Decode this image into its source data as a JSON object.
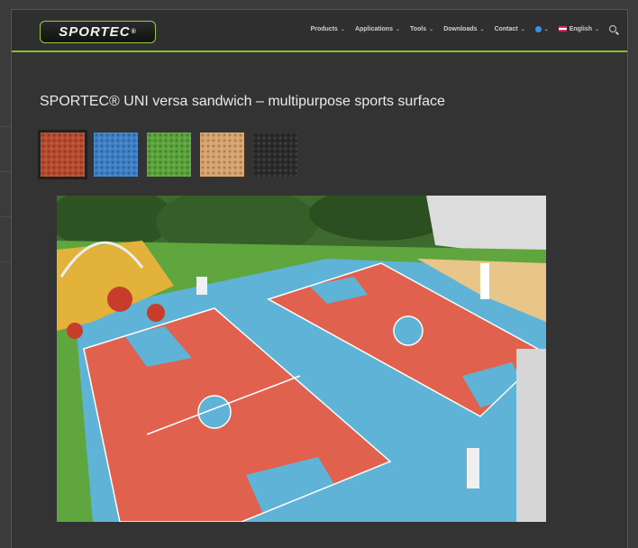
{
  "header": {
    "logo_text": "SPORTEC",
    "logo_mark": "®",
    "nav": [
      {
        "label": "Products"
      },
      {
        "label": "Applications"
      },
      {
        "label": "Tools"
      },
      {
        "label": "Downloads"
      },
      {
        "label": "Contact"
      }
    ],
    "language": "English",
    "accent_color": "#8bbd2d"
  },
  "page": {
    "title": "SPORTEC® UNI versa sandwich – multipurpose sports surface"
  },
  "swatches": [
    {
      "name": "red",
      "color": "#b84a2e",
      "selected": true
    },
    {
      "name": "blue",
      "color": "#3f7fc6",
      "selected": false
    },
    {
      "name": "green",
      "color": "#5aa33b",
      "selected": false
    },
    {
      "name": "beige",
      "color": "#d6a36c",
      "selected": false
    },
    {
      "name": "black",
      "color": "#2b2b2b",
      "selected": false
    }
  ]
}
